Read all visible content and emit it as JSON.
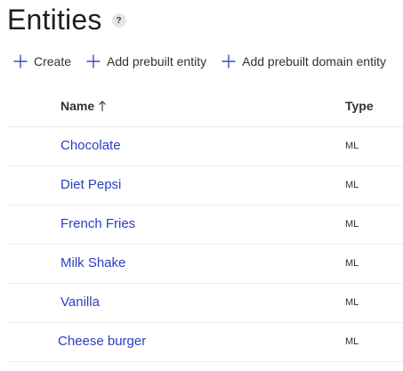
{
  "header": {
    "title": "Entities",
    "help_label": "?"
  },
  "toolbar": {
    "create_label": "Create",
    "add_prebuilt_label": "Add prebuilt entity",
    "add_prebuilt_domain_label": "Add prebuilt domain entity",
    "icon": "plus-icon"
  },
  "table": {
    "columns": {
      "name": "Name",
      "type": "Type",
      "sort": "ascending"
    },
    "rows": [
      {
        "name": "Chocolate",
        "type": "ML"
      },
      {
        "name": "Diet Pepsi",
        "type": "ML"
      },
      {
        "name": "French Fries",
        "type": "ML"
      },
      {
        "name": "Milk Shake",
        "type": "ML"
      },
      {
        "name": "Vanilla",
        "type": "ML"
      },
      {
        "name": "Cheese burger",
        "type": "ML"
      }
    ]
  },
  "colors": {
    "link": "#2b3ec2",
    "accent": "#3b4cc0",
    "divider": "#edebe9"
  }
}
